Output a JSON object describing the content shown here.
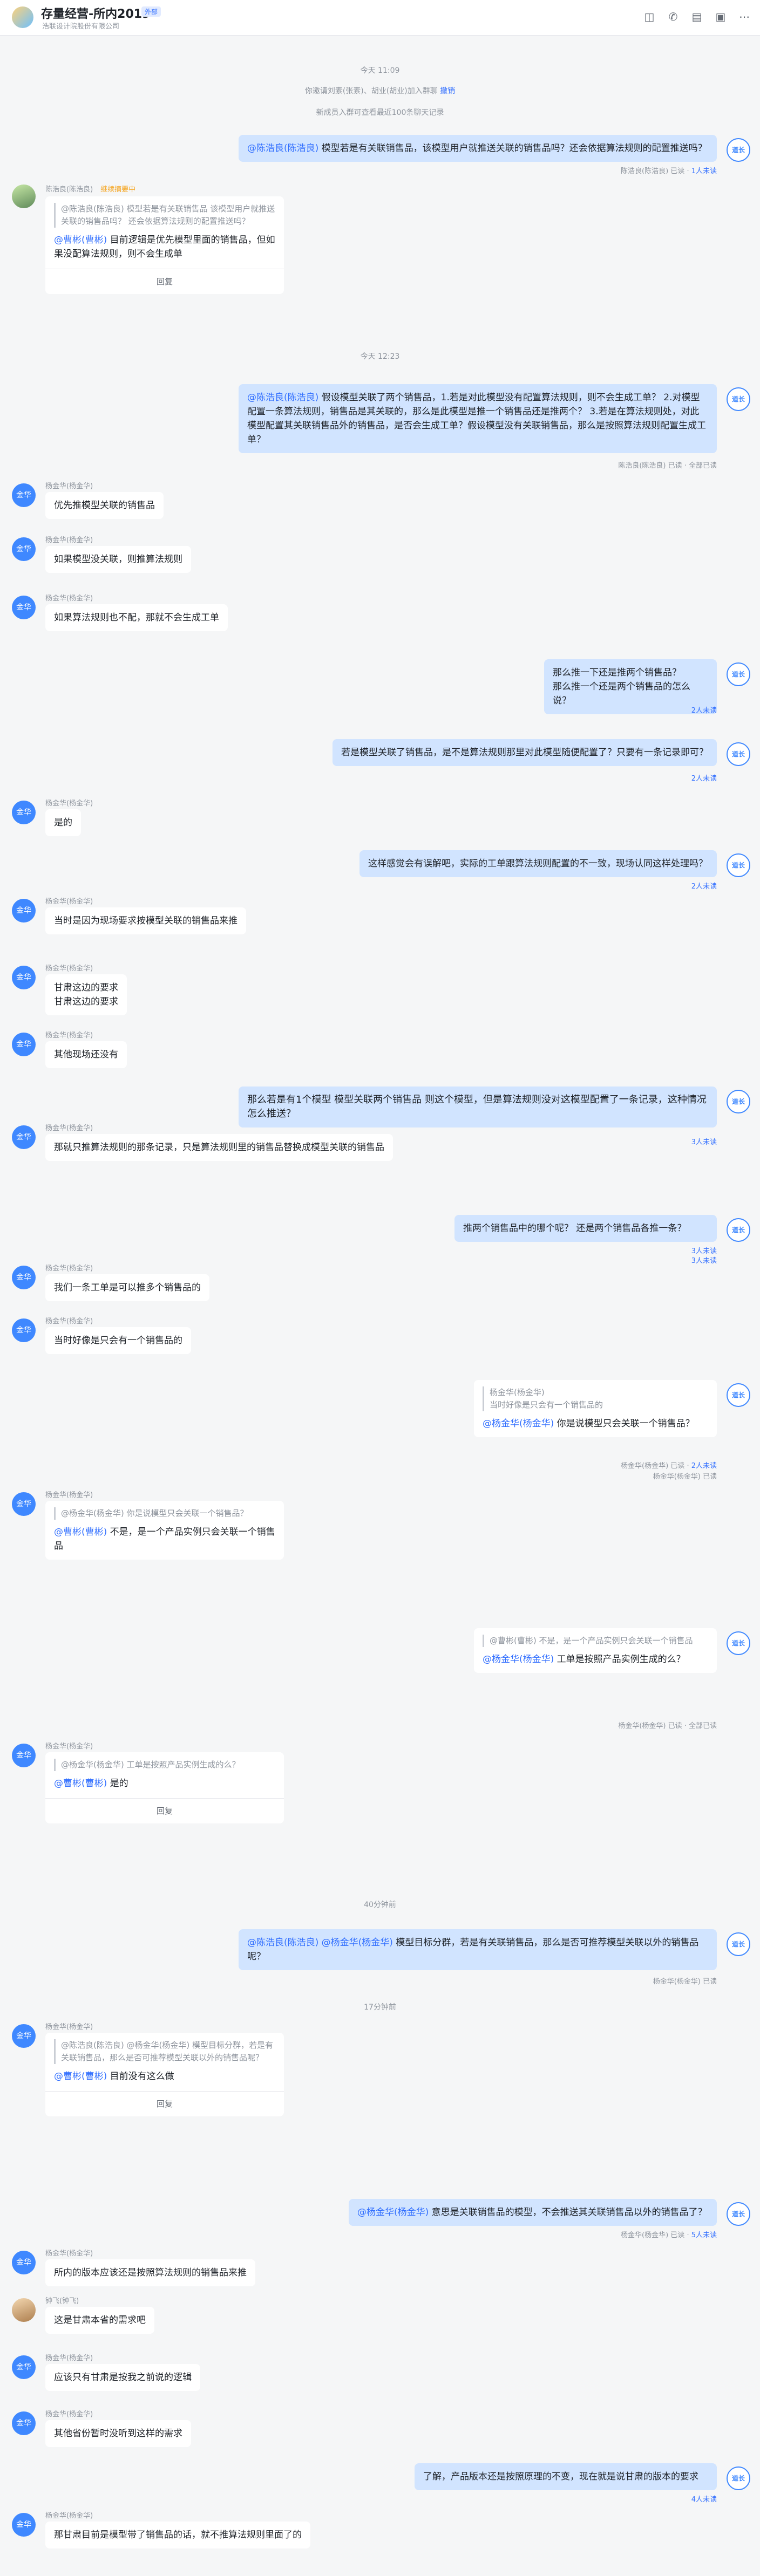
{
  "header": {
    "title": "存量经营-所内2019",
    "tag": "外部",
    "subtitle": "浩联设计院股份有限公司",
    "tools": [
      "video-call-icon",
      "phone-icon",
      "doc-icon",
      "folder-icon",
      "more-icon"
    ]
  },
  "system": {
    "t1": "今天 11:09",
    "join_text": "你邀请刘素(张素)、胡业(胡业)加入群聊",
    "join_link": "撤销",
    "history": "新成员入群可查看最近100条聊天记录",
    "t2": "今天 12:23",
    "t3": "40分钟前",
    "t4": "17分钟前"
  },
  "names": {
    "chen": "陈浩良(陈浩良)",
    "chen_extra": "继续摘要中",
    "yang": "杨金华(杨金华)",
    "zhong": "钟飞(钟飞)",
    "right_avatar": "道长"
  },
  "messages": {
    "m1": {
      "mention": "@陈浩良(陈浩良)",
      "text": " 模型若是有关联销售品，该模型用户就推送关联的销售品吗？还会依据算法规则的配置推送吗？",
      "status": "陈浩良(陈浩良) 已读 · ",
      "status_link": "1人未读"
    },
    "m2": {
      "quote_mention": "@陈浩良(陈浩良)",
      "quote": " 模型若是有关联销售品 该模型用户就推送关联的销售品吗？ 还会依据算法规则的配置推送吗？",
      "mention": "@曹彬(曹彬)",
      "text": " 目前逻辑是优先模型里面的销售品，但如果没配算法规则，则不会生成单",
      "reply": "回复"
    },
    "m3": {
      "mention": "@陈浩良(陈浩良)",
      "text": " 假设模型关联了两个销售品，1.若是对此模型没有配置算法规则，则不会生成工单？ 2.对模型配置一条算法规则，销售品是其关联的，那么是此模型是推一个销售品还是推两个？ 3.若是在算法规则处，对此模型配置其关联销售品外的销售品，是否会生成工单？假设模型没有关联销售品，那么是按照算法规则配置生成工单？",
      "status": "陈浩良(陈浩良) 已读 · 全部已读"
    },
    "m4": {
      "text": "优先推模型关联的销售品"
    },
    "m5": {
      "text": "如果模型没关联，则推算法规则"
    },
    "m6": {
      "text": "如果算法规则也不配，那就不会生成工单"
    },
    "m7": {
      "line1": "那么推一下还是推两个销售品？",
      "line2": "那么推一个还是两个销售品的怎么说？",
      "status": "2人未读"
    },
    "m8": {
      "text": "若是模型关联了销售品，是不是算法规则那里对此模型随便配置了？只要有一条记录即可？",
      "status": "2人未读"
    },
    "m9": {
      "text": "是的"
    },
    "m10": {
      "text": "这样感觉会有误解吧，实际的工单跟算法规则配置的不一致，现场认同这样处理吗？",
      "status": "2人未读"
    },
    "m11": {
      "text": "当时是因为现场要求按模型关联的销售品来推"
    },
    "m12": {
      "line1": "甘肃这边的要求",
      "line2": "甘肃这边的要求"
    },
    "m13": {
      "text": "其他现场还没有"
    },
    "m14": {
      "text": "那么若是有1个模型 模型关联两个销售品 则这个模型，但是算法规则没对这模型配置了一条记录，这种情况怎么推送？",
      "status": "3人未读"
    },
    "m15": {
      "text": "那就只推算法规则的那条记录，只是算法规则里的销售品替换成模型关联的销售品"
    },
    "m16": {
      "text": "推两个销售品中的哪个呢？ 还是两个销售品各推一条？",
      "status1": "3人未读",
      "status2": "3人未读"
    },
    "m17": {
      "text": "我们一条工单是可以推多个销售品的"
    },
    "m18": {
      "text": "当时好像是只会有一个销售品的"
    },
    "m19": {
      "quote_name": "杨金华(杨金华)",
      "quote": "当时好像是只会有一个销售品的",
      "mention": "@杨金华(杨金华)",
      "text": " 你是说模型只会关联一个销售品？",
      "status1": "杨金华(杨金华) 已读 · ",
      "status_link": "2人未读",
      "status2": "杨金华(杨金华) 已读"
    },
    "m20": {
      "quote_mention": "@杨金华(杨金华)",
      "quote": " 你是说模型只会关联一个销售品？",
      "mention": "@曹彬(曹彬)",
      "text": " 不是，是一个产品实例只会关联一个销售品",
      "reply": "回复"
    },
    "m21": {
      "quote_mention": "@曹彬(曹彬)",
      "quote": " 不是，是一个产品实例只会关联一个销售品",
      "mention": "@杨金华(杨金华)",
      "text": " 工单是按照产品实例生成的么？",
      "status": "杨金华(杨金华) 已读 · 全部已读"
    },
    "m22": {
      "quote_mention": "@杨金华(杨金华)",
      "quote": " 工单是按照产品实例生成的么？",
      "mention": "@曹彬(曹彬)",
      "text": " 是的",
      "reply": "回复"
    },
    "m23": {
      "mention1": "@陈浩良(陈浩良)",
      "mention2": " @杨金华(杨金华)",
      "text": " 模型目标分群，若是有关联销售品，那么是否可推荐模型关联以外的销售品呢？",
      "status": "杨金华(杨金华) 已读"
    },
    "m24": {
      "quote_mention": "@陈浩良(陈浩良) @杨金华(杨金华)",
      "quote": " 模型目标分群，若是有关联销售品，那么是否可推荐模型关联以外的销售品呢？",
      "mention": "@曹彬(曹彬)",
      "text": " 目前没有这么做",
      "reply": "回复"
    },
    "m25": {
      "mention": "@杨金华(杨金华)",
      "text": " 意思是关联销售品的模型，不会推送其关联销售品以外的销售品了？",
      "status": "杨金华(杨金华) 已读 · ",
      "status_link": "5人未读"
    },
    "m26": {
      "text": "所内的版本应该还是按照算法规则的销售品来推"
    },
    "m27": {
      "text": "这是甘肃本省的需求吧"
    },
    "m28": {
      "text": "应该只有甘肃是按我之前说的逻辑"
    },
    "m29": {
      "text": "其他省份暂时没听到这样的需求"
    },
    "m30": {
      "text": "了解，产品版本还是按照原理的不变，现在就是说甘肃的版本的要求",
      "status": "4人未读"
    },
    "m31": {
      "text": "那甘肃目前是模型带了销售品的话，就不推算法规则里面了的"
    }
  }
}
